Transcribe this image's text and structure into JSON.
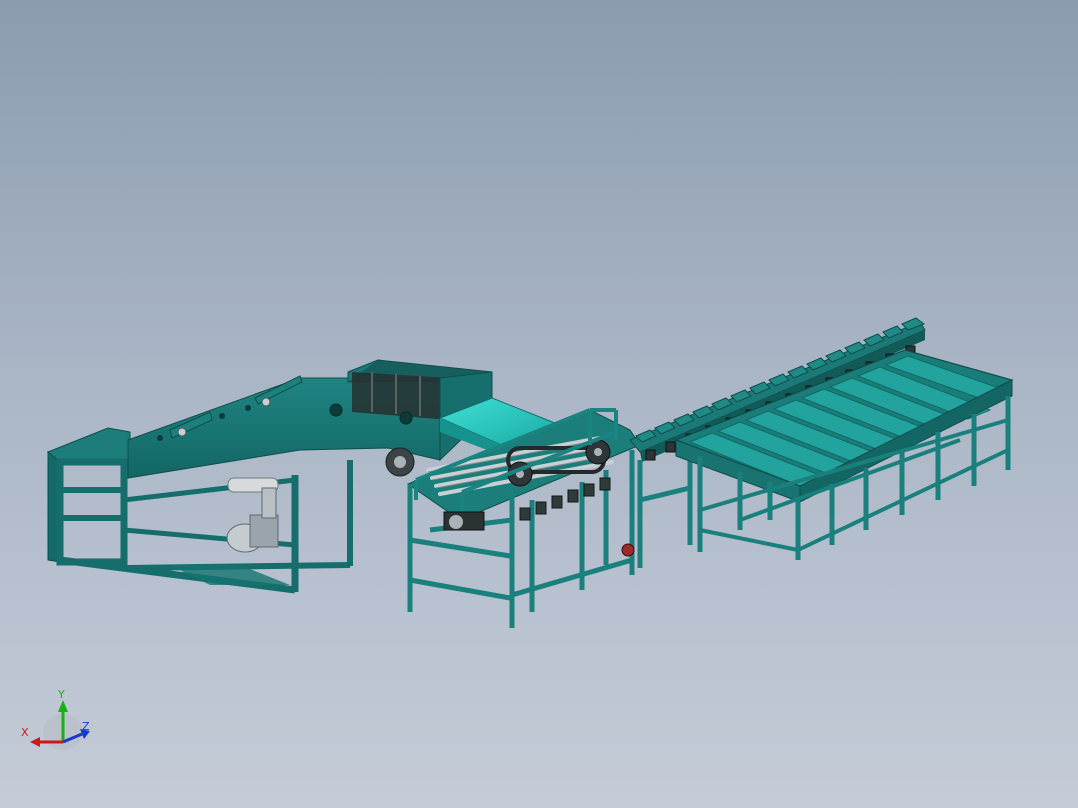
{
  "triad": {
    "x_label": "X",
    "y_label": "Y",
    "z_label": "Z"
  },
  "colors": {
    "frame": "#1a7a78",
    "frame_dark": "#0f5654",
    "frame_light": "#2a9994",
    "belt": "#2ed0c8",
    "steel": "#9aa4aa",
    "axis_x": "#d01818",
    "axis_y": "#18b018",
    "axis_z": "#1838d0"
  }
}
